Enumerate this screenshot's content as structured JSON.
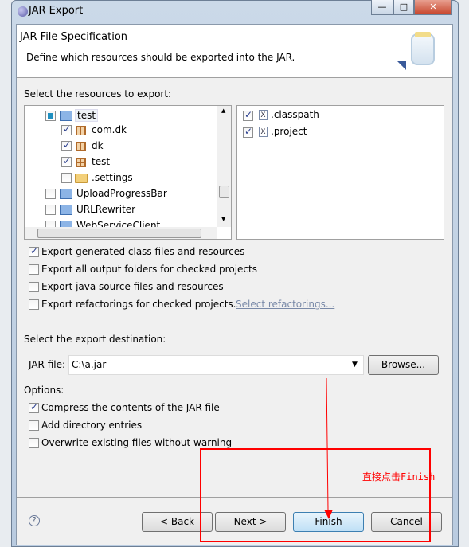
{
  "window": {
    "title": "JAR Export",
    "controls": [
      "minimize",
      "maximize",
      "close"
    ]
  },
  "header": {
    "title": "JAR File Specification",
    "description": "Define which resources should be exported into the JAR.",
    "icon": "jar-icon"
  },
  "resources": {
    "label": "Select the resources to export:",
    "tree": [
      {
        "label": "test",
        "state": "partial",
        "icon": "project-folder-icon",
        "level": 1,
        "selected": true
      },
      {
        "label": "com.dk",
        "state": "checked",
        "icon": "package-icon",
        "level": 2
      },
      {
        "label": "dk",
        "state": "checked",
        "icon": "package-icon",
        "level": 2
      },
      {
        "label": "test",
        "state": "checked",
        "icon": "package-icon",
        "level": 2
      },
      {
        "label": ".settings",
        "state": "unchecked",
        "icon": "folder-icon",
        "level": 2
      },
      {
        "label": "UploadProgressBar",
        "state": "unchecked",
        "icon": "web-project-icon",
        "level": 1
      },
      {
        "label": "URLRewriter",
        "state": "unchecked",
        "icon": "web-project-icon",
        "level": 1
      },
      {
        "label": "WebServiceClient",
        "state": "unchecked",
        "icon": "web-project-icon",
        "level": 1
      }
    ],
    "files": [
      {
        "label": ".classpath",
        "state": "checked",
        "icon": "xml-file-icon"
      },
      {
        "label": ".project",
        "state": "checked",
        "icon": "xml-file-icon"
      }
    ]
  },
  "export_options": [
    {
      "label": "Export generated class files and resources",
      "checked": true
    },
    {
      "label": "Export all output folders for checked projects",
      "checked": false
    },
    {
      "label": "Export java source files and resources",
      "checked": false
    },
    {
      "label": "Export refactorings for checked projects.",
      "checked": false
    }
  ],
  "select_refactorings_link": "Select refactorings...",
  "destination": {
    "label": "Select the export destination:",
    "jar_label": "JAR file:",
    "jar_value": "C:\\a.jar",
    "browse": "Browse..."
  },
  "options": {
    "label": "Options:",
    "items": [
      {
        "label": "Compress the contents of the JAR file",
        "checked": true
      },
      {
        "label": "Add directory entries",
        "checked": false
      },
      {
        "label": "Overwrite existing files without warning",
        "checked": false
      }
    ]
  },
  "buttons": {
    "back": "< Back",
    "next": "Next >",
    "finish": "Finish",
    "cancel": "Cancel"
  },
  "annotation": {
    "text": "直接点击Finish",
    "color": "#ff0000"
  }
}
